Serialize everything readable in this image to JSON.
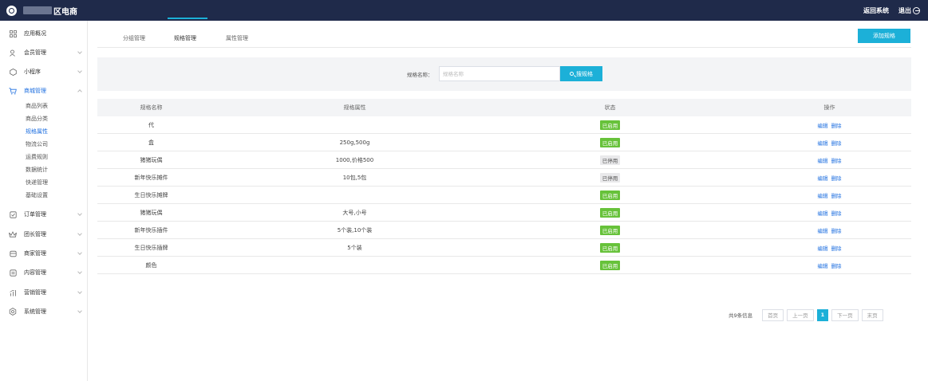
{
  "header": {
    "brand": "区电商",
    "return_label": "返回系统",
    "logout_label": "退出"
  },
  "sidebar": {
    "items": [
      {
        "label": "应用概况",
        "icon": "grid-icon"
      },
      {
        "label": "会员管理",
        "icon": "user-icon"
      },
      {
        "label": "小程序",
        "icon": "hexagon-icon"
      },
      {
        "label": "商城管理",
        "icon": "cart-icon",
        "active": true
      },
      {
        "label": "订单管理",
        "icon": "clipboard-icon"
      },
      {
        "label": "团长管理",
        "icon": "crown-icon"
      },
      {
        "label": "商家管理",
        "icon": "store-icon"
      },
      {
        "label": "内容管理",
        "icon": "document-icon"
      },
      {
        "label": "营销管理",
        "icon": "chart-icon"
      },
      {
        "label": "系统管理",
        "icon": "gear-icon"
      }
    ],
    "subitems": [
      "商品列表",
      "商品分类",
      "规格属性",
      "物流公司",
      "运费规则",
      "数据统计",
      "快递管理",
      "基础设置"
    ]
  },
  "tabs": [
    "分组管理",
    "规格管理",
    "属性管理"
  ],
  "add_button": "添加规格",
  "search": {
    "label": "规格名称：",
    "placeholder": "规格名称",
    "button": "搜规格"
  },
  "table": {
    "columns": [
      "规格名称",
      "规格属性",
      "状态",
      "操作"
    ],
    "rows": [
      {
        "name": "代",
        "attr": "",
        "status": "已启用",
        "enabled": true
      },
      {
        "name": "盒",
        "attr": "250g,500g",
        "status": "已启用",
        "enabled": true
      },
      {
        "name": "猪猪玩偶",
        "attr": "1000,价格500",
        "status": "已停用",
        "enabled": false
      },
      {
        "name": "新年快乐摊件",
        "attr": "10包,5包",
        "status": "已停用",
        "enabled": false
      },
      {
        "name": "生日快乐摊牌",
        "attr": "",
        "status": "已启用",
        "enabled": true
      },
      {
        "name": "猪猪玩偶",
        "attr": "大号,小号",
        "status": "已启用",
        "enabled": true
      },
      {
        "name": "新年快乐插件",
        "attr": "5个装,10个装",
        "status": "已启用",
        "enabled": true
      },
      {
        "name": "生日快乐插牌",
        "attr": "5个装",
        "status": "已启用",
        "enabled": true
      },
      {
        "name": "颜色",
        "attr": "",
        "status": "已启用",
        "enabled": true
      }
    ],
    "edit_label": "编辑",
    "delete_label": "删除"
  },
  "pagination": {
    "total": "共9条信息",
    "first": "首页",
    "prev": "上一页",
    "current": "1",
    "next": "下一页",
    "last": "末页"
  }
}
